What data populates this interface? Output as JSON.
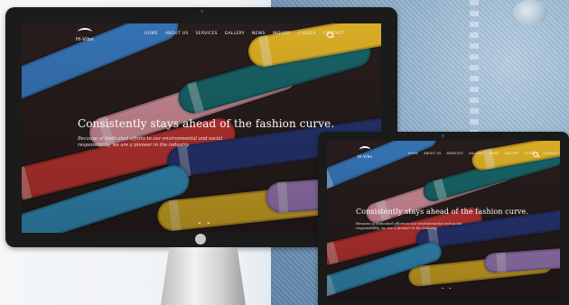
{
  "website": {
    "brand": {
      "text": "Hi-Vibe"
    },
    "nav": {
      "items": [
        "HOME",
        "ABOUT US",
        "SERVICES",
        "GALLERY",
        "NEWS",
        "INQUIRY",
        "CAREER",
        "CONTACT"
      ],
      "search_icon": "search-icon"
    },
    "hero": {
      "headline": "Consistently stays ahead of the fashion curve.",
      "subtext": "Because of dedicated efforts to our environmental and social responsibility, we are a pioneer in the industry.",
      "scroll_icon": "chevron-down-icon"
    }
  },
  "devices": {
    "monitor_logo_icon": "apple-logo-icon"
  },
  "colors": {
    "monitor_bezel": "#1b1b1b",
    "laptop_bezel": "#1a1a1a",
    "spool_red": "#d13a37",
    "spool_teal": "#1b6e72",
    "spool_yellow": "#f1c12a",
    "spool_pink": "#e49aa7",
    "spool_blue": "#3b7fc7",
    "spool_purple": "#b08ad1"
  }
}
